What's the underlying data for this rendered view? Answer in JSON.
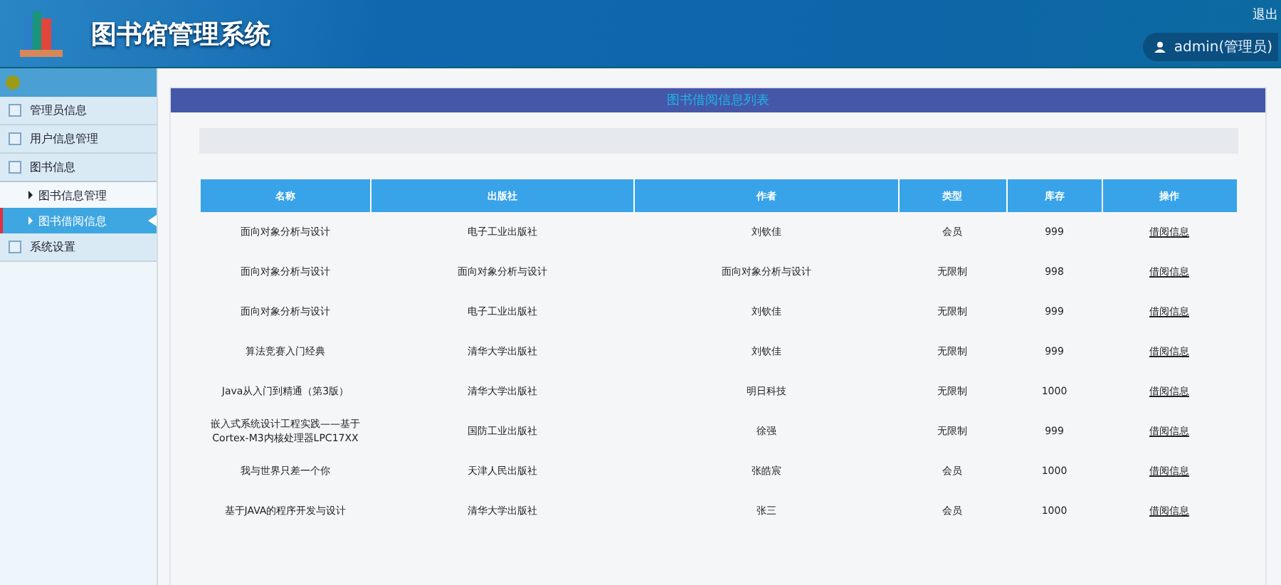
{
  "header": {
    "title": "图书馆管理系统",
    "logout": "退出",
    "user": "admin(管理员)"
  },
  "sidebar": {
    "items": [
      {
        "label": "管理员信息",
        "selected": false
      },
      {
        "label": "用户信息管理",
        "selected": false
      },
      {
        "label": "图书信息",
        "selected": false,
        "expanded": true,
        "children": [
          {
            "label": "图书信息管理",
            "selected": false
          },
          {
            "label": "图书借阅信息",
            "selected": true
          }
        ]
      },
      {
        "label": "系统设置",
        "selected": false
      }
    ]
  },
  "panel": {
    "title": "图书借阅信息列表"
  },
  "table": {
    "columns": [
      "名称",
      "出版社",
      "作者",
      "类型",
      "库存",
      "操作"
    ],
    "rows": [
      [
        "面向对象分析与设计",
        "电子工业出版社",
        "刘钦佳",
        "会员",
        "999",
        "借阅信息"
      ],
      [
        "面向对象分析与设计",
        "面向对象分析与设计",
        "面向对象分析与设计",
        "无限制",
        "998",
        "借阅信息"
      ],
      [
        "面向对象分析与设计",
        "电子工业出版社",
        "刘钦佳",
        "无限制",
        "999",
        "借阅信息"
      ],
      [
        "算法竞赛入门经典",
        "清华大学出版社",
        "刘钦佳",
        "无限制",
        "999",
        "借阅信息"
      ],
      [
        "Java从入门到精通（第3版）",
        "清华大学出版社",
        "明日科技",
        "无限制",
        "1000",
        "借阅信息"
      ],
      [
        "嵌入式系统设计工程实践——基于Cortex-M3内核处理器LPC17XX",
        "国防工业出版社",
        "徐强",
        "无限制",
        "999",
        "借阅信息"
      ],
      [
        "我与世界只差一个你",
        "天津人民出版社",
        "张皓宸",
        "会员",
        "1000",
        "借阅信息"
      ],
      [
        "基于JAVA的程序开发与设计",
        "清华大学出版社",
        "张三",
        "会员",
        "1000",
        "借阅信息"
      ]
    ]
  }
}
